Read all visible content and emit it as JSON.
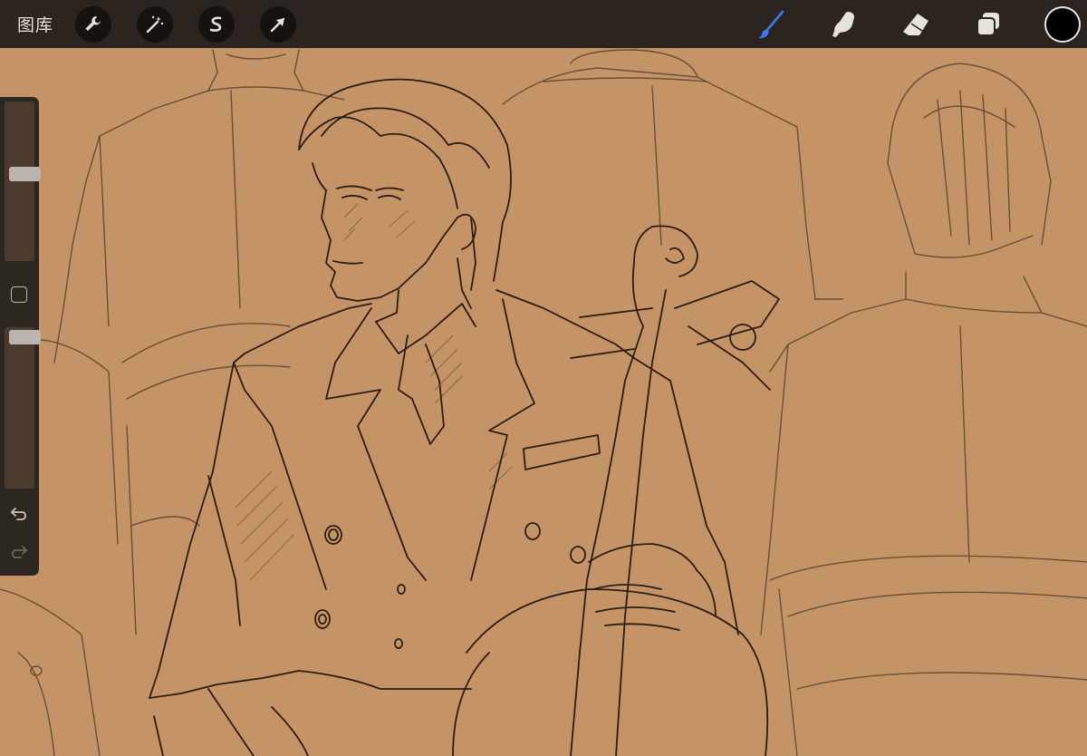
{
  "topbar": {
    "gallery_label": "图库",
    "tools_left": [
      {
        "name": "actions",
        "icon": "wrench-icon"
      },
      {
        "name": "adjustments",
        "icon": "magic-wand-icon"
      },
      {
        "name": "selection",
        "icon": "selection-s-icon"
      },
      {
        "name": "transform",
        "icon": "arrow-cursor-icon"
      }
    ],
    "tools_right": [
      {
        "name": "brush",
        "icon": "paintbrush-icon",
        "active": true
      },
      {
        "name": "smudge",
        "icon": "smudge-finger-icon",
        "active": false
      },
      {
        "name": "eraser",
        "icon": "eraser-icon",
        "active": false
      },
      {
        "name": "layers",
        "icon": "layers-icon",
        "active": false
      }
    ],
    "current_color": "#000000"
  },
  "sidebar": {
    "brush_size_level": 0.55,
    "opacity_level": 0.98,
    "modify_icon": "square-icon",
    "undo_icon": "undo-icon",
    "redo_icon": "redo-icon"
  },
  "canvas": {
    "background_color": "#c49466",
    "content": "pencil-sketch-artwork"
  },
  "colors": {
    "toolbar_bg": "#2b241f",
    "active_tool": "#3a7bf0",
    "icon_light": "#e6e2dc",
    "sketch_line": "#2a1d12"
  }
}
